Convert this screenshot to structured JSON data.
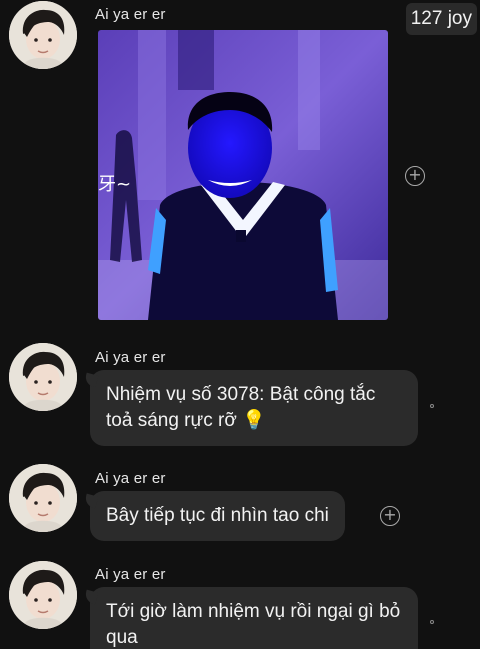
{
  "badge": {
    "text": "127 joy"
  },
  "messages": [
    {
      "sender": "Ai ya er er",
      "type": "sticker",
      "sticker_caption": "牙~"
    },
    {
      "sender": "Ai ya er er",
      "type": "text",
      "text": "Nhiệm vụ số 3078: Bật công tắc toả sáng rực rỡ",
      "emoji": "💡"
    },
    {
      "sender": "Ai ya er er",
      "type": "text",
      "text": "Bây tiếp tục đi nhìn tao chi"
    },
    {
      "sender": "Ai ya er er",
      "type": "text",
      "text": "Tới giờ làm nhiệm vụ rồi ngại gì bỏ qua"
    }
  ],
  "icons": {
    "add_reaction": "plus-circle-icon",
    "status": "circle-dot-icon"
  },
  "colors": {
    "background": "#111111",
    "bubble": "#2b2b2b",
    "sticker_glow": "#3b2bf0"
  }
}
